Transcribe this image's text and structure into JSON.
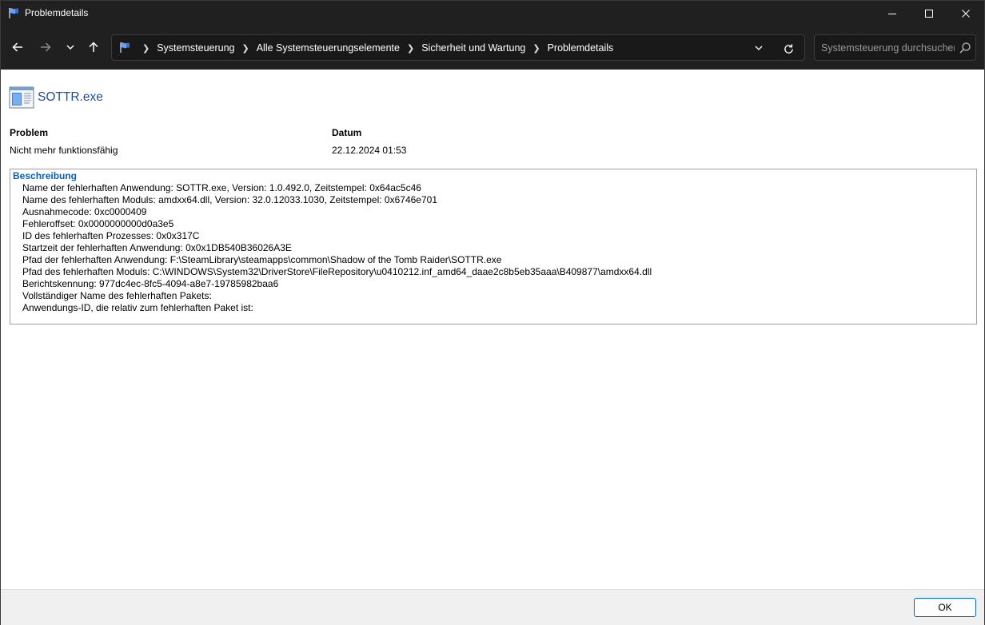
{
  "window": {
    "title": "Problemdetails",
    "icon": "flag-icon"
  },
  "nav": {
    "breadcrumbs": [
      "Systemsteuerung",
      "Alle Systemsteuerungselemente",
      "Sicherheit und Wartung",
      "Problemdetails"
    ],
    "search_placeholder": "Systemsteuerung durchsuchen"
  },
  "app": {
    "name": "SOTTR.exe"
  },
  "details": {
    "problem_label": "Problem",
    "problem_value": "Nicht mehr funktionsfähig",
    "date_label": "Datum",
    "date_value": "22.12.2024 01:53"
  },
  "description": {
    "title": "Beschreibung",
    "lines": [
      "Name der fehlerhaften Anwendung: SOTTR.exe, Version: 1.0.492.0, Zeitstempel: 0x64ac5c46",
      "Name des fehlerhaften Moduls: amdxx64.dll, Version: 32.0.12033.1030, Zeitstempel: 0x6746e701",
      "Ausnahmecode: 0xc0000409",
      "Fehleroffset: 0x0000000000d0a3e5",
      "ID des fehlerhaften Prozesses: 0x0x317C",
      "Startzeit der fehlerhaften Anwendung: 0x0x1DB540B36026A3E",
      "Pfad der fehlerhaften Anwendung: F:\\SteamLibrary\\steamapps\\common\\Shadow of the Tomb Raider\\SOTTR.exe",
      "Pfad des fehlerhaften Moduls: C:\\WINDOWS\\System32\\DriverStore\\FileRepository\\u0410212.inf_amd64_daae2c8b5eb35aaa\\B409877\\amdxx64.dll",
      "Berichtskennung: 977dc4ec-8fc5-4094-a8e7-19785982baa6",
      "Vollständiger Name des fehlerhaften Pakets:",
      "Anwendungs-ID, die relativ zum fehlerhaften Paket ist:"
    ]
  },
  "footer": {
    "ok_label": "OK"
  },
  "colors": {
    "titlebar_bg": "#202020",
    "link_blue": "#1a4fa0",
    "section_blue": "#0a5fb4",
    "button_border": "#0067c0"
  }
}
